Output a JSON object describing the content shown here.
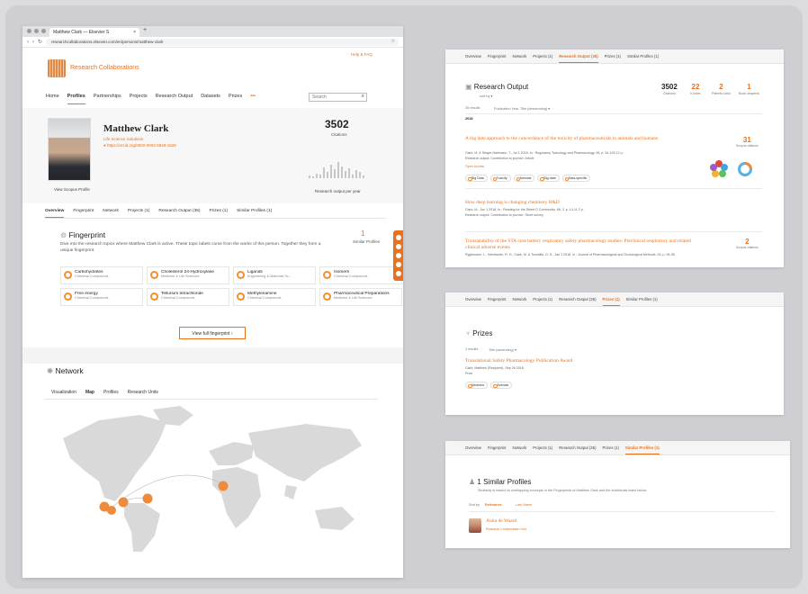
{
  "browser": {
    "tab_title": "Matthew Clark — Elsevier S",
    "close": "×",
    "new_tab": "+",
    "url": "researchcollaborations.elsevier.com/en/persons/matthew-clark",
    "back": "‹",
    "forward": "›",
    "reload": "↻",
    "bookmark": "☆"
  },
  "header": {
    "brand": "Research Collaborations",
    "help": "Help & FAQ",
    "nav": [
      "Home",
      "Profiles",
      "Partnerships",
      "Projects",
      "Research Output",
      "Datasets",
      "Prizes",
      "•••"
    ],
    "search_placeholder": "Search",
    "search_icon": "⌕"
  },
  "profile": {
    "name": "Matthew Clark",
    "org": "Life Science Solutions",
    "orcid": "https://orcid.org/0000-0002-5948-1528",
    "photo_link": "View Scopus Profile",
    "citations": "3502",
    "citations_label": "Citations",
    "bars_label": "Research output per year",
    "bar_levels": [
      0.15,
      0.1,
      0.25,
      0.2,
      0.55,
      0.3,
      0.7,
      0.45,
      0.8,
      0.6,
      0.35,
      0.5,
      0.2,
      0.4,
      0.3,
      0.15
    ]
  },
  "subtabs": [
    "Overview",
    "Fingerprint",
    "Network",
    "Projects (1)",
    "Research Output (35)",
    "Prizes (1)",
    "Similar Profiles (1)"
  ],
  "fingerprint": {
    "title": "Fingerprint",
    "desc": "Dive into the research topics where Matthew Clark is active. These topic labels come from the works of this person. Together they form a unique fingerprint.",
    "similar_count": "1",
    "similar_label": "Similar Profiles",
    "view_btn": "View full fingerprint ›",
    "concepts": [
      {
        "t": "Carbohydrates",
        "s": "Chemical Compounds"
      },
      {
        "t": "Cholesterol 24-Hydroxylase",
        "s": "Medicine & Life Sciences"
      },
      {
        "t": "Ligands",
        "s": "Engineering & Materials Sc..."
      },
      {
        "t": "Isomers",
        "s": "Chemical Compounds"
      },
      {
        "t": "Free energy",
        "s": "Chemical Compounds"
      },
      {
        "t": "Tellurium tetrachloride",
        "s": "Chemical Compounds"
      },
      {
        "t": "Methylenamine",
        "s": "Chemical Compounds"
      },
      {
        "t": "Pharmaceutical Preparations",
        "s": "Medicine & Life Sciences"
      }
    ]
  },
  "network": {
    "title": "Network",
    "tabs": [
      "Visualization",
      "Map",
      "Profiles",
      "Research Units"
    ]
  },
  "output_panel": {
    "tabs": [
      "Overview",
      "Fingerprint",
      "Network",
      "Projects (1)",
      "Research Output (35)",
      "Prizes (1)",
      "Similar Profiles (1)"
    ],
    "title": "Research Output",
    "sort": "sort by ▾",
    "filter": "35 results",
    "sortline": "Publication Year, Title (descending) ▾",
    "year": "2018",
    "stats": [
      {
        "n": "3502",
        "l": "Citations",
        "c": "#222"
      },
      {
        "n": "22",
        "l": "h-Index",
        "c": "#e9711c"
      },
      {
        "n": "2",
        "l": "Patents cited",
        "c": "#e9711c"
      },
      {
        "n": "1",
        "l": "Book chapters",
        "c": "#e9711c"
      }
    ],
    "items": [
      {
        "title": "A big data approach to the concordance of the toxicity of pharmaceuticals in animals and humans",
        "meta": "Clark, M. & Steger-Hartmann, T., Jul 1 2018, In : Regulatory Toxicology and Pharmacology. 96, p. 94-105 12 p.",
        "meta2": "Research output: Contribution to journal › Article",
        "oa": "Open Access",
        "chips": [
          "Big Data",
          "Toxicity",
          "Animals",
          "Big data",
          "Data-specific"
        ],
        "metric": "31",
        "metric_label": "Scopus citations"
      },
      {
        "title": "How deep learning is changing chemistry R&D",
        "meta": "Clark, M., Jun 1 2018, In : Reading for the Street D Community. 66, 3, p. 14-11 2 p.",
        "meta2": "Research output: Contribution to journal › Short survey"
      },
      {
        "title": "Translatability of the STA core battery respiratory safety pharmacology studies: Preclinical respiratory and related clinical adverse events",
        "meta": "Ryglemann, L., Wentworth, R. H., Clark, M. & Tomalitis, G. S., Jan 1 2018, In : Journal of Pharmacological and Toxicological Methods. 93, p. 94-96",
        "metric": "2",
        "metric_label": "Scopus citations"
      }
    ]
  },
  "prizes_panel": {
    "tabs": [
      "Overview",
      "Fingerprint",
      "Network",
      "Projects (1)",
      "Research Output (35)",
      "Prizes (1)",
      "Similar Profiles (1)"
    ],
    "title": "Prizes",
    "filter": "1 results",
    "sortline": "Title (ascending) ▾",
    "award": "Translational Safety Pharmacology Publication Award",
    "meta": "Clark, Matthew (Recipient), Sep 26 2018",
    "meta2": "Prize",
    "chips": [
      "Medicine",
      "Animals"
    ]
  },
  "similar_panel": {
    "tabs": [
      "Overview",
      "Fingerprint",
      "Network",
      "Projects (1)",
      "Research Output (35)",
      "Prizes (1)",
      "Similar Profiles (1)"
    ],
    "title": "1 Similar Profiles",
    "desc": "Similarity is based on overlapping concepts in the Fingerprints of Matthew Clark and the individuals listed below.",
    "sortby": "Sort by",
    "sort1": "Relevance",
    "sort2": "Last Name",
    "person": "Anita de Waard",
    "person_org": "Research Collaboration Unit"
  },
  "colors": {
    "accent": "#e9711c",
    "map": "#d7d7d7"
  }
}
